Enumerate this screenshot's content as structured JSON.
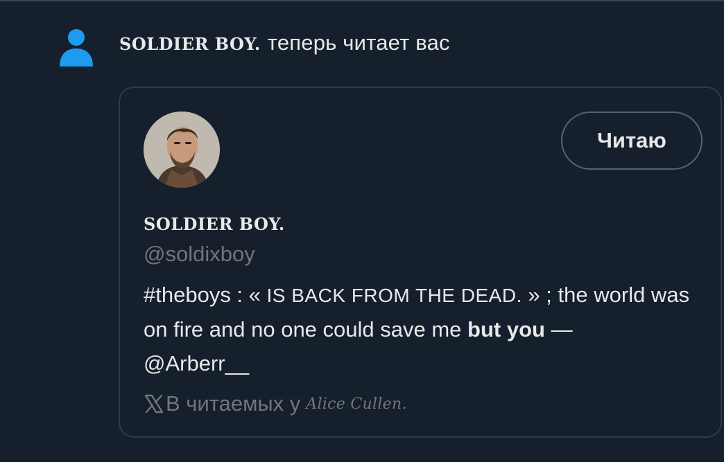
{
  "notification": {
    "icon": "person-icon",
    "icon_color": "#1d9bf0",
    "user_name": "SOLDIER BOY.",
    "action_text": "теперь читает вас"
  },
  "profile_card": {
    "avatar": "avatar",
    "follow_button_label": "Читаю",
    "display_name": "SOLDIER BOY.",
    "handle": "@soldixboy",
    "bio": {
      "hashtag": "#theboys : « ",
      "caps_phrase": "IS BACK FROM THE DEAD.",
      "middle": " » ; the world was on fire and no one could save me ",
      "bold_phrase": "but you",
      "dash": " —",
      "mention": "@Arberr__"
    },
    "followed_by": {
      "icon": "x-logo-icon",
      "prefix": "В читаемых у",
      "name": "Alice Cullen."
    }
  },
  "colors": {
    "background": "#16202c",
    "text_primary": "#e7e9ea",
    "text_secondary": "#71767b",
    "border": "#2f3b45",
    "accent": "#1d9bf0"
  }
}
